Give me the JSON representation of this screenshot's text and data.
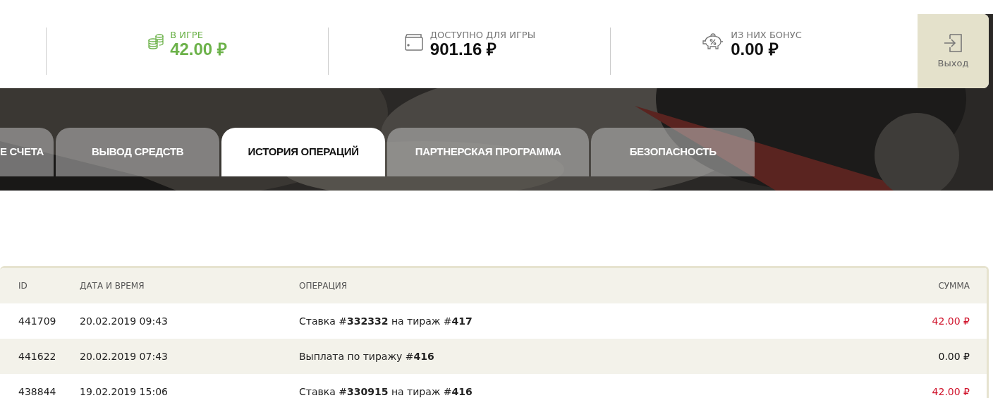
{
  "balances": [
    {
      "kind": "in_game",
      "label": "В ИГРЕ",
      "amount": "42.00 ₽"
    },
    {
      "kind": "available",
      "label": "ДОСТУПНО ДЛЯ ИГРЫ",
      "amount": "901.16 ₽"
    },
    {
      "kind": "bonus",
      "label": "ИЗ НИХ БОНУС",
      "amount": "0.00 ₽"
    }
  ],
  "logout": {
    "label": "Выход"
  },
  "tabs": [
    {
      "label": "Е СЧЕТА",
      "selected": false
    },
    {
      "label": "ВЫВОД СРЕДСТВ",
      "selected": false
    },
    {
      "label": "ИСТОРИЯ ОПЕРАЦИЙ",
      "selected": true
    },
    {
      "label": "ПАРТНЕРСКАЯ ПРОГРАММА",
      "selected": false
    },
    {
      "label": "БЕЗОПАСНОСТЬ",
      "selected": false
    }
  ],
  "table": {
    "columns": [
      "ID",
      "ДАТА И ВРЕМЯ",
      "ОПЕРАЦИЯ",
      "СУММА"
    ],
    "rows": [
      {
        "id": "441709",
        "datetime": "20.02.2019 09:43",
        "operation": "Ставка #**332332** на тираж #**417**",
        "amount": "42.00 ₽",
        "kind": "bet"
      },
      {
        "id": "441622",
        "datetime": "20.02.2019 07:43",
        "operation": "Выплата по тиражу #**416**",
        "amount": "0.00 ₽",
        "kind": "payout"
      },
      {
        "id": "438844",
        "datetime": "19.02.2019 15:06",
        "operation": "Ставка #**330915** на тираж #**416**",
        "amount": "42.00 ₽",
        "kind": "bet"
      }
    ]
  }
}
